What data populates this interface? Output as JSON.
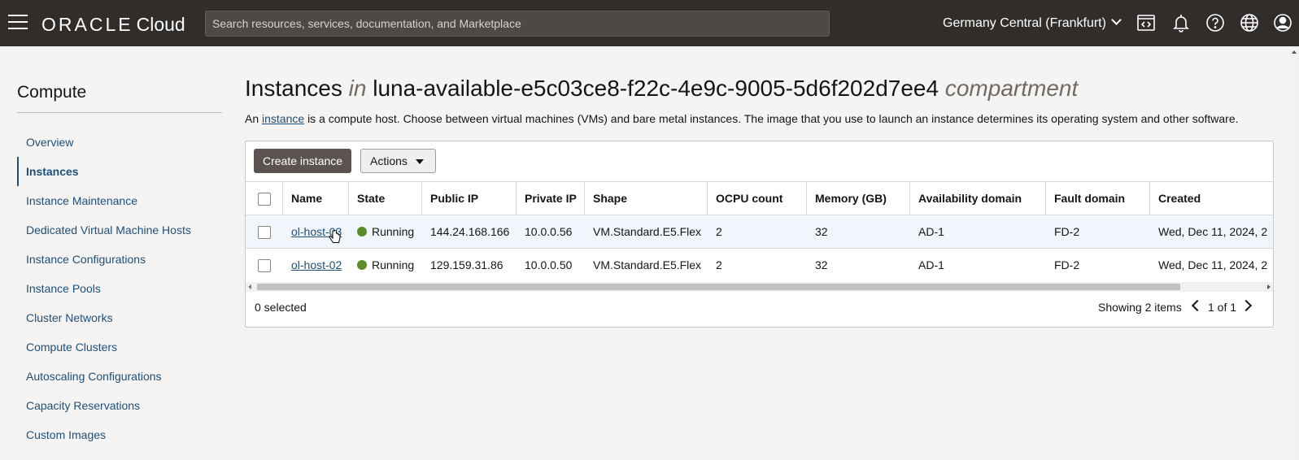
{
  "topbar": {
    "menu_icon": "hamburger-menu-icon",
    "logo_brand": "ORACLE",
    "logo_product": "Cloud",
    "search_placeholder": "Search resources, services, documentation, and Marketplace",
    "region": "Germany Central (Frankfurt)",
    "icons": [
      "code-editor-icon",
      "bell-icon",
      "help-icon",
      "globe-icon",
      "user-icon"
    ]
  },
  "sidebar": {
    "title": "Compute",
    "items": [
      {
        "label": "Overview",
        "active": false
      },
      {
        "label": "Instances",
        "active": true
      },
      {
        "label": "Instance Maintenance",
        "active": false
      },
      {
        "label": "Dedicated Virtual Machine Hosts",
        "active": false
      },
      {
        "label": "Instance Configurations",
        "active": false
      },
      {
        "label": "Instance Pools",
        "active": false
      },
      {
        "label": "Cluster Networks",
        "active": false
      },
      {
        "label": "Compute Clusters",
        "active": false
      },
      {
        "label": "Autoscaling Configurations",
        "active": false
      },
      {
        "label": "Capacity Reservations",
        "active": false
      },
      {
        "label": "Custom Images",
        "active": false
      }
    ]
  },
  "main": {
    "title_prefix": "Instances",
    "title_in": "in",
    "compartment": "luna-available-e5c03ce8-f22c-4e9c-9005-5d6f202d7ee4",
    "title_suffix": "compartment",
    "desc_pre": "An",
    "desc_link": "instance",
    "desc_post": "is a compute host. Choose between virtual machines (VMs) and bare metal instances. The image that you use to launch an instance determines its operating system and other software.",
    "create_button": "Create instance",
    "actions_button": "Actions",
    "columns": [
      "Name",
      "State",
      "Public IP",
      "Private IP",
      "Shape",
      "OCPU count",
      "Memory (GB)",
      "Availability domain",
      "Fault domain",
      "Created"
    ],
    "rows": [
      {
        "name": "ol-host-03",
        "state": "Running",
        "public_ip": "144.24.168.166",
        "private_ip": "10.0.0.56",
        "shape": "VM.Standard.E5.Flex",
        "ocpu": "2",
        "memory": "32",
        "ad": "AD-1",
        "fd": "FD-2",
        "created": "Wed, Dec 11, 2024, 2"
      },
      {
        "name": "ol-host-02",
        "state": "Running",
        "public_ip": "129.159.31.86",
        "private_ip": "10.0.0.50",
        "shape": "VM.Standard.E5.Flex",
        "ocpu": "2",
        "memory": "32",
        "ad": "AD-1",
        "fd": "FD-2",
        "created": "Wed, Dec 11, 2024, 2"
      }
    ],
    "selected_text": "0 selected",
    "showing_text": "Showing 2 items",
    "pager_text": "1 of 1",
    "colors": {
      "running": "#5b8c2a",
      "topbar": "#312d2a",
      "link": "#1e4f79"
    }
  }
}
